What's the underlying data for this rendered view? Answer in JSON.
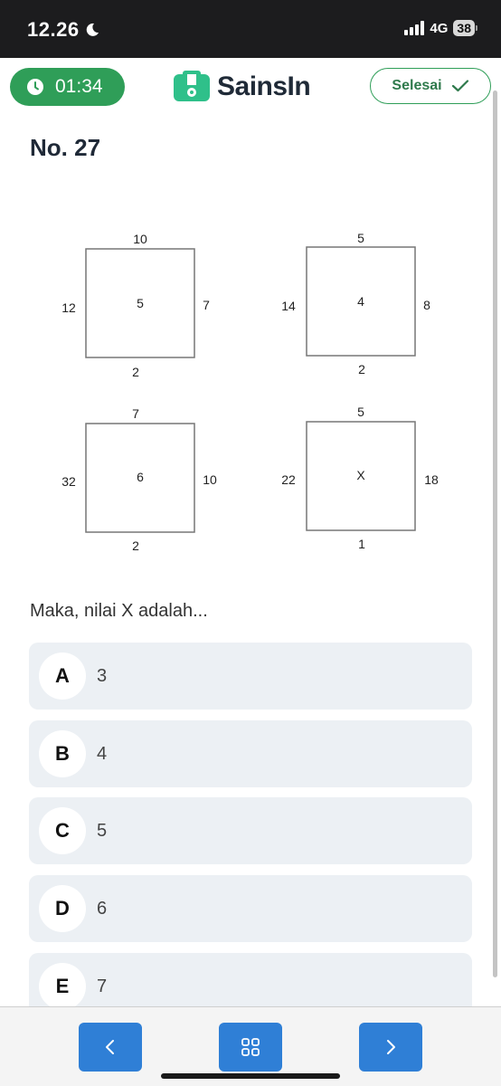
{
  "status_bar": {
    "time": "12.26",
    "network": "4G",
    "battery": "38"
  },
  "header": {
    "timer": "01:34",
    "logo_text": "SainsIn",
    "finish_label": "Selesai"
  },
  "question": {
    "number_label": "No. 27",
    "prompt": "Maka, nilai X adalah...",
    "figure": {
      "squares": [
        {
          "top": "10",
          "left": "12",
          "center": "5",
          "right": "7",
          "bottom": "2"
        },
        {
          "top": "5",
          "left": "14",
          "center": "4",
          "right": "8",
          "bottom": "2"
        },
        {
          "top": "7",
          "left": "32",
          "center": "6",
          "right": "10",
          "bottom": "2"
        },
        {
          "top": "5",
          "left": "22",
          "center": "X",
          "right": "18",
          "bottom": "1"
        }
      ]
    }
  },
  "options": [
    {
      "letter": "A",
      "value": "3"
    },
    {
      "letter": "B",
      "value": "4"
    },
    {
      "letter": "C",
      "value": "5"
    },
    {
      "letter": "D",
      "value": "6"
    },
    {
      "letter": "E",
      "value": "7"
    }
  ],
  "colors": {
    "accent_green": "#2f9e58",
    "nav_blue": "#2f7fd6",
    "option_bg": "#ecf0f4"
  },
  "icons": {
    "prev": "chevron-left-icon",
    "grid": "grid-icon",
    "next": "chevron-right-icon"
  }
}
